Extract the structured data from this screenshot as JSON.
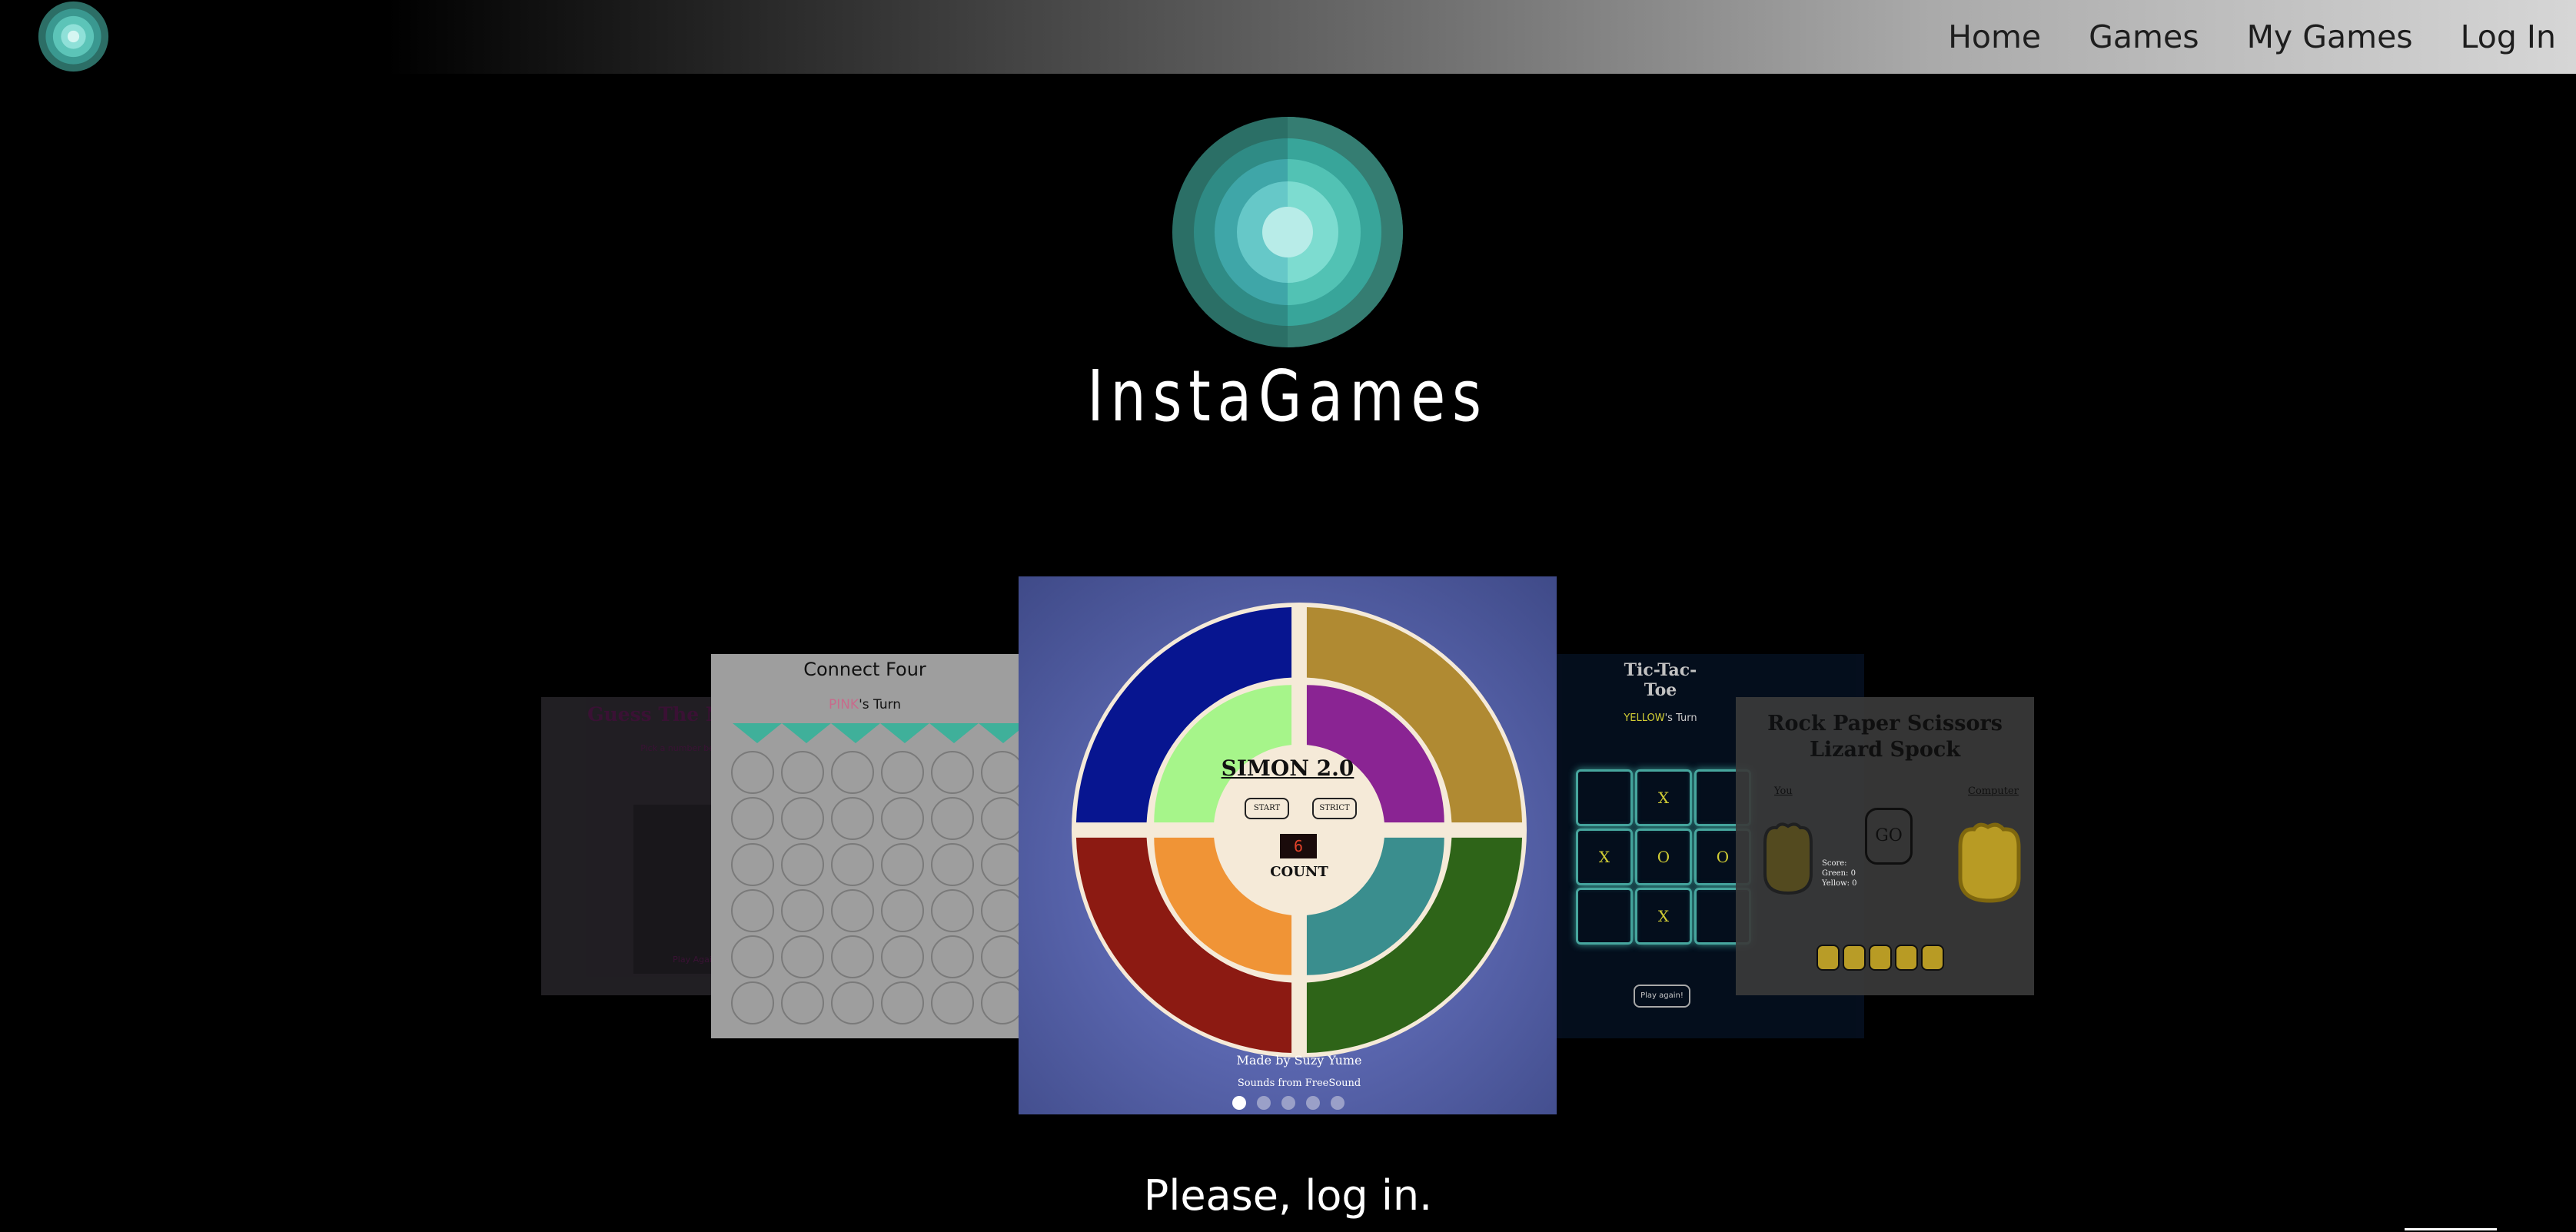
{
  "nav": {
    "logo_icon": "target-rings-logo",
    "links": [
      "Home",
      "Games",
      "My Games",
      "Log In"
    ]
  },
  "hero": {
    "logo_icon": "concentric-circles-logo",
    "title": "InstaGames"
  },
  "carousel": {
    "slides": {
      "guess": {
        "title": "Guess The Number",
        "subtitle": "Pick a number between",
        "play_again": "Play Again"
      },
      "connect_four": {
        "title": "Connect Four",
        "turn_player": "PINK",
        "turn_suffix": "'s Turn"
      },
      "simon": {
        "title": "SIMON 2.0",
        "start": "START",
        "strict": "STRICT",
        "count_value": "6",
        "count_label": "COUNT",
        "credit": "Made by Suzy Yume",
        "sounds": "Sounds from FreeSound"
      },
      "tictactoe": {
        "title": "Tic-Tac-Toe",
        "turn_player": "YELLOW",
        "turn_suffix": "'s Turn",
        "cells": [
          "",
          "X",
          "",
          "X",
          "O",
          "O",
          "",
          "X",
          ""
        ],
        "play_again": "Play again!"
      },
      "rpsls": {
        "title_line1": "Rock Paper Scissors",
        "title_line2": "Lizard Spock",
        "you": "You",
        "computer": "Computer",
        "go": "GO",
        "score": "Score:",
        "green": "Green: 0",
        "yellow": "Yellow: 0"
      }
    },
    "dots_count": 5,
    "active_dot": 0
  },
  "footer": {
    "message": "Please, log in."
  },
  "colors": {
    "logo_teal": "#4fc0b0",
    "simon_blue": "#0a1a90",
    "simon_gold": "#b08a32",
    "simon_red": "#8c1a12",
    "simon_green": "#2e6418"
  }
}
